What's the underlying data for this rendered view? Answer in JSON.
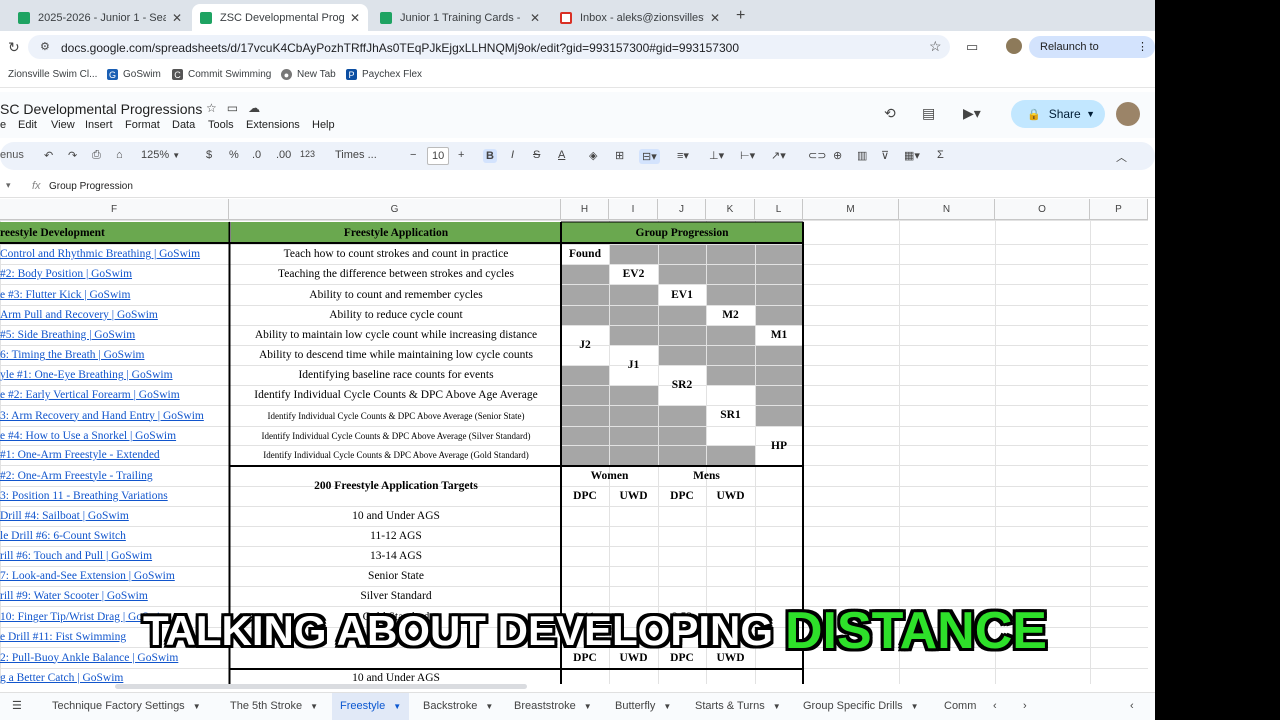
{
  "browser": {
    "tabs": [
      {
        "title": "2025-2026 - Junior 1 - Seas",
        "icon": "sheets-icon",
        "active": false
      },
      {
        "title": "ZSC Developmental Progress",
        "icon": "sheets-icon",
        "active": true
      },
      {
        "title": "Junior 1 Training Cards - Goo",
        "icon": "sheets-icon",
        "active": false
      },
      {
        "title": "Inbox - aleks@zionsvilleswim",
        "icon": "gmail-icon",
        "active": false
      }
    ],
    "new_tab": "+",
    "url": "docs.google.com/spreadsheets/d/17vcuK4CbAyPozhTRffJhAs0TEqPJkEjgxLLHNQMj9ok/edit?gid=993157300#gid=993157300",
    "relaunch": "Relaunch to update",
    "bookmarks": [
      {
        "label": "Zionsville Swim Cl...",
        "icon": "sheets-icon"
      },
      {
        "label": "GoSwim",
        "icon": "goswim-icon"
      },
      {
        "label": "Commit Swimming",
        "icon": "commit-icon"
      },
      {
        "label": "New Tab",
        "icon": "globe-icon"
      },
      {
        "label": "Paychex Flex",
        "icon": "paychex-icon"
      }
    ]
  },
  "sheet": {
    "title": "SC Developmental Progressions",
    "menu": [
      "e",
      "Edit",
      "View",
      "Insert",
      "Format",
      "Data",
      "Tools",
      "Extensions",
      "Help"
    ],
    "share": "Share",
    "toolbar": {
      "search_menus": "enus",
      "zoom": "125%",
      "currency": "$",
      "percent": "%",
      "dec_minus": ".0",
      "dec_plus": ".00",
      "number_format": "123",
      "font": "Times ...",
      "font_size": "10"
    },
    "formula_bar": {
      "fx": "fx",
      "value": "Group Progression"
    },
    "columns": [
      "F",
      "G",
      "H",
      "I",
      "J",
      "K",
      "L",
      "M",
      "N",
      "O",
      "P"
    ],
    "headers": {
      "f": "reestyle Development",
      "g": "Freestyle Application",
      "hl": "Group Progression"
    },
    "links": [
      "Control and Rhythmic Breathing | GoSwim",
      "#2: Body Position | GoSwim",
      "e #3: Flutter Kick | GoSwim",
      "Arm Pull and Recovery | GoSwim",
      "#5: Side Breathing | GoSwim",
      "6: Timing the Breath | GoSwim",
      "yle #1: One-Eye Breathing | GoSwim",
      "e #2: Early Vertical Forearm | GoSwim",
      "3: Arm Recovery and Hand Entry | GoSwim",
      "e #4: How to Use a Snorkel | GoSwim",
      "#1: One-Arm Freestyle - Extended",
      "#2: One-Arm Freestyle - Trailing",
      "3: Position 11 - Breathing Variations",
      "Drill #4: Sailboat | GoSwim",
      "le Drill #6: 6-Count Switch",
      "rill #6: Touch and Pull | GoSwim",
      "7: Look-and-See Extension | GoSwim",
      "rill #9: Water Scooter | GoSwim",
      "10: Finger Tip/Wrist Drag | GoSwim",
      "e Drill #11: Fist Swimming",
      "2: Pull-Buoy Ankle Balance | GoSwim",
      "g a Better Catch | GoSwim"
    ],
    "applications": [
      "Teach how to count strokes and count in practice",
      "Teaching the difference between strokes and cycles",
      "Ability to count and remember cycles",
      "Ability to reduce cycle count",
      "Ability to maintain low cycle count while increasing distance",
      "Ability to descend time while maintaining low cycle counts",
      "Identifying baseline race counts for events",
      "Identify Individual Cycle Counts & DPC Above Age Average",
      "Identify Individual Cycle Counts & DPC Above Average (Senior State)",
      "Identify Individual Cycle Counts & DPC Above Average (Silver Standard)",
      "Identify Individual Cycle Counts & DPC Above Average (Gold Standard)"
    ],
    "groups": {
      "found": "Found",
      "ev2": "EV2",
      "ev1": "EV1",
      "m2": "M2",
      "m1": "M1",
      "j2": "J2",
      "j1": "J1",
      "sr2": "SR2",
      "sr1": "SR1",
      "hp": "HP"
    },
    "targets": {
      "title": "200 Freestyle Application Targets",
      "women": "Women",
      "mens": "Mens",
      "dpc": "DPC",
      "uwd": "UWD",
      "rows": [
        "10 and Under AGS",
        "11-12 AGS",
        "13-14 AGS",
        "Senior State",
        "Silver Standard",
        "Gold Standard"
      ],
      "gold_women_dpc": "2.11",
      "gold_men_dpc": "2.53",
      "next_row": "10 and Under AGS"
    },
    "sheet_tabs": [
      "Technique Factory Settings",
      "The 5th Stroke",
      "Freestyle",
      "Backstroke",
      "Breaststroke",
      "Butterfly",
      "Starts & Turns",
      "Group Specific Drills",
      "Comm"
    ],
    "active_tab": "Freestyle"
  },
  "overlay": {
    "white": "TALKING ABOUT DEVELOPING",
    "green": "DISTANCE"
  },
  "colors": {
    "header_green": "#6aa84f",
    "shade_gray": "#a6a6a6",
    "link_blue": "#1155cc",
    "overlay_green": "#2ee02a"
  }
}
